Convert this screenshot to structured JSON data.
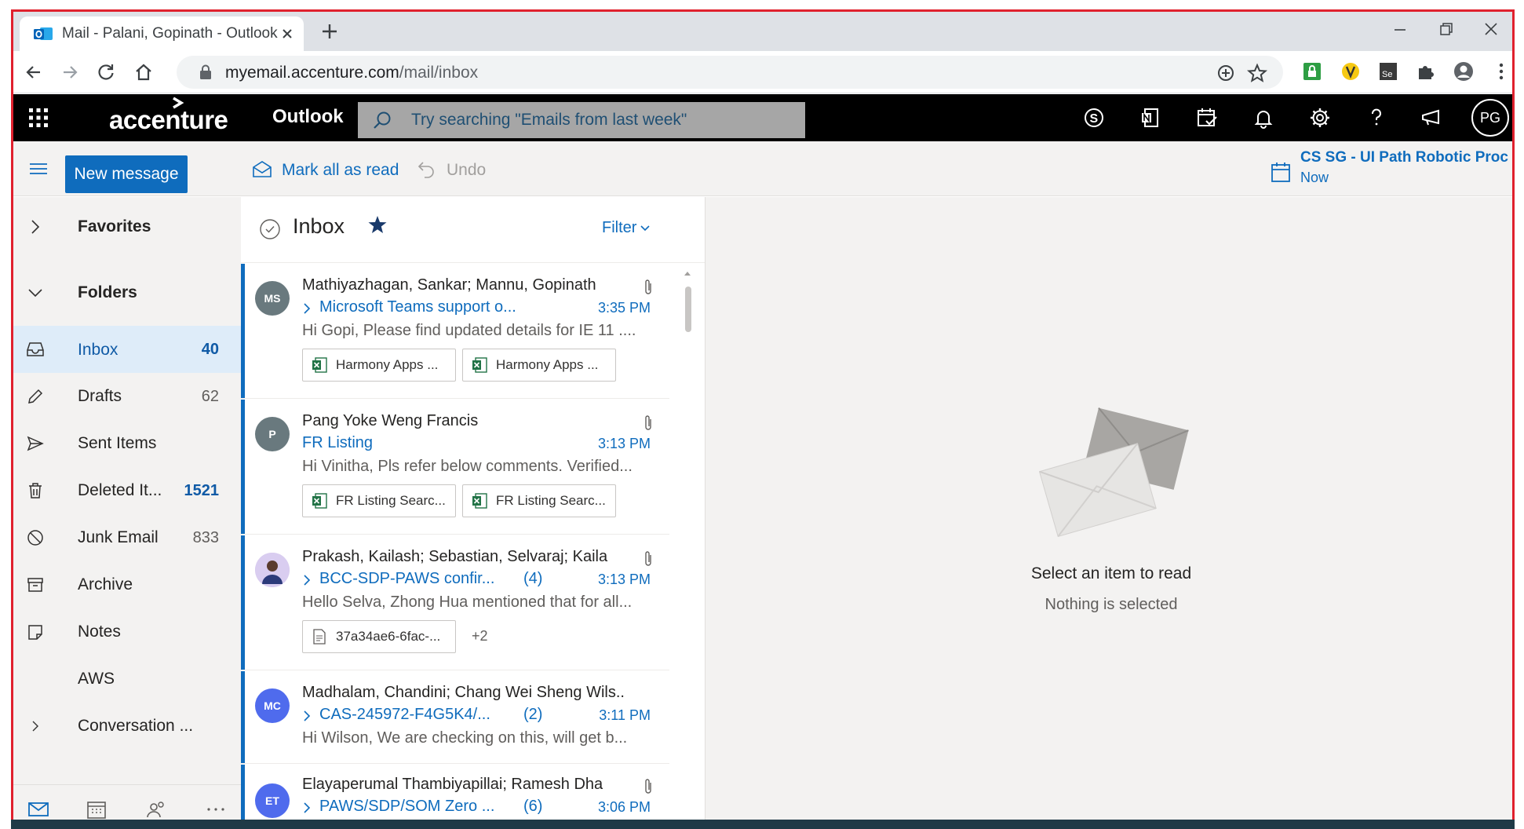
{
  "browser": {
    "tab_title": "Mail - Palani, Gopinath - Outlook",
    "url_host": "myemail.accenture.com",
    "url_path": "/mail/inbox"
  },
  "header": {
    "logo": "accenture",
    "app_name": "Outlook",
    "search_placeholder": "Try searching \"Emails from last week\"",
    "user_initials": "PG"
  },
  "command_bar": {
    "new_message": "New message",
    "mark_all_read": "Mark all as read",
    "undo": "Undo",
    "reminder_title": "CS SG - UI Path Robotic Proc",
    "reminder_time": "Now"
  },
  "nav": {
    "favorites": "Favorites",
    "folders": "Folders",
    "items": [
      {
        "label": "Inbox",
        "count": "40"
      },
      {
        "label": "Drafts",
        "count": "62"
      },
      {
        "label": "Sent Items",
        "count": ""
      },
      {
        "label": "Deleted It...",
        "count": "1521"
      },
      {
        "label": "Junk Email",
        "count": "833"
      },
      {
        "label": "Archive",
        "count": ""
      },
      {
        "label": "Notes",
        "count": ""
      },
      {
        "label": "AWS",
        "count": ""
      },
      {
        "label": "Conversation ...",
        "count": ""
      }
    ]
  },
  "list": {
    "title": "Inbox",
    "filter": "Filter",
    "messages": [
      {
        "initials": "MS",
        "sender": "Mathiyazhagan, Sankar; Mannu, Gopinath",
        "subject": "Microsoft Teams support o...",
        "count": "",
        "time": "3:35 PM",
        "preview": "Hi Gopi, Please find updated details for IE 11 ....",
        "attachments": [
          "Harmony Apps ...",
          "Harmony Apps ..."
        ],
        "more": ""
      },
      {
        "initials": "P",
        "sender": "Pang Yoke Weng Francis",
        "subject": "FR Listing",
        "count": "",
        "time": "3:13 PM",
        "preview": "Hi Vinitha, Pls refer below comments. Verified...",
        "attachments": [
          "FR Listing Searc...",
          "FR Listing Searc..."
        ],
        "more": ""
      },
      {
        "initials": "",
        "sender": "Prakash, Kailash; Sebastian, Selvaraj; Kaila",
        "subject": "BCC-SDP-PAWS confir...",
        "count": "(4)",
        "time": "3:13 PM",
        "preview": "Hello Selva, Zhong Hua mentioned that for all...",
        "attachments": [
          "37a34ae6-6fac-..."
        ],
        "more": "+2"
      },
      {
        "initials": "MC",
        "sender": "Madhalam, Chandini; Chang Wei Sheng Wils..",
        "subject": "CAS-245972-F4G5K4/...",
        "count": "(2)",
        "time": "3:11 PM",
        "preview": "Hi Wilson, We are checking on this, will get b...",
        "attachments": [],
        "more": ""
      },
      {
        "initials": "ET",
        "sender": "Elayaperumal Thambiyapillai; Ramesh Dha",
        "subject": "PAWS/SDP/SOM Zero ...",
        "count": "(6)",
        "time": "3:06 PM",
        "preview": "",
        "attachments": [],
        "more": ""
      }
    ]
  },
  "reading": {
    "title": "Select an item to read",
    "subtitle": "Nothing is selected"
  },
  "colors": {
    "accent": "#0f6cbd",
    "frame": "#e0212e",
    "avatar_ms": "#69797e",
    "avatar_p": "#69797e",
    "avatar_mc": "#4f6bed",
    "avatar_et": "#4f6bed"
  }
}
